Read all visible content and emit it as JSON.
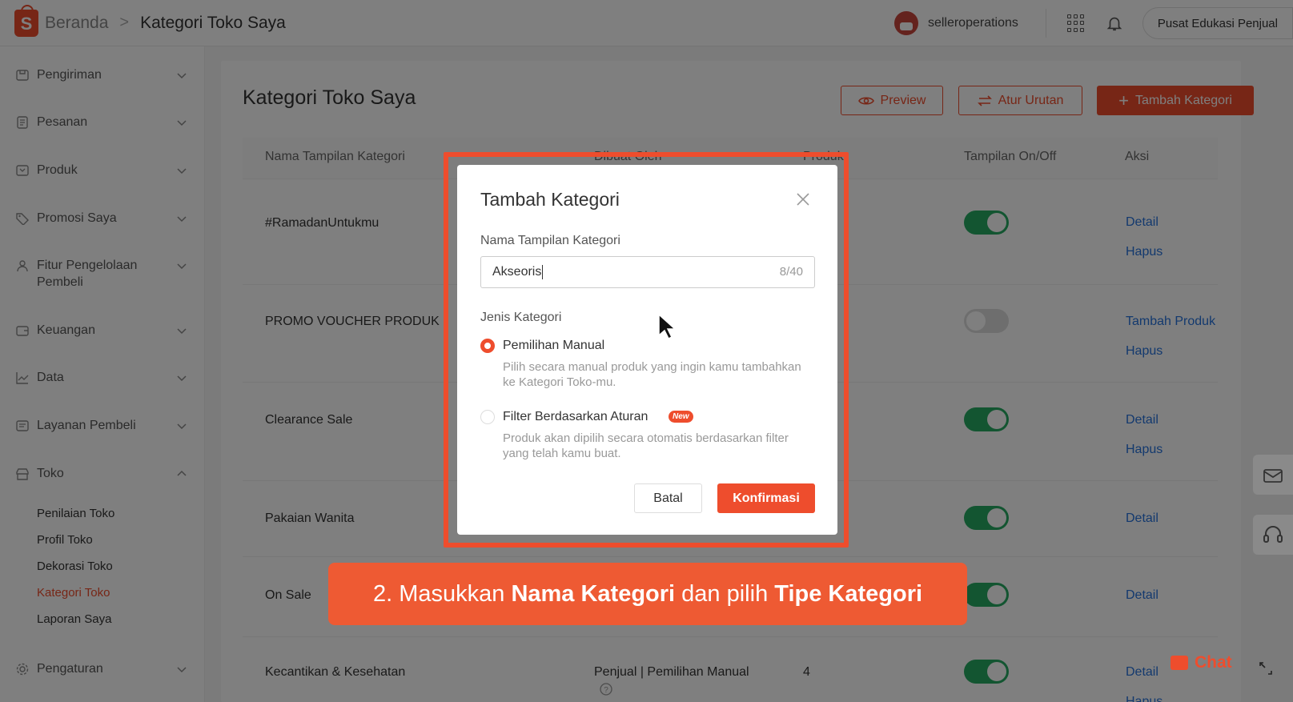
{
  "topbar": {
    "logo_text": "S",
    "breadcrumb_home": "Beranda",
    "breadcrumb_sep": ">",
    "breadcrumb_current": "Kategori Toko Saya",
    "username": "selleroperations",
    "pusat_btn": "Pusat Edukasi Penjual"
  },
  "sidebar": {
    "items": [
      {
        "label": "Pengiriman",
        "icon": "shipping-icon"
      },
      {
        "label": "Pesanan",
        "icon": "order-icon"
      },
      {
        "label": "Produk",
        "icon": "product-icon"
      },
      {
        "label": "Promosi Saya",
        "icon": "tag-icon"
      },
      {
        "label": "Fitur Pengelolaan Pembeli",
        "icon": "people-icon"
      },
      {
        "label": "Keuangan",
        "icon": "wallet-icon"
      },
      {
        "label": "Data",
        "icon": "chart-icon"
      },
      {
        "label": "Layanan Pembeli",
        "icon": "service-icon"
      },
      {
        "label": "Toko",
        "icon": "store-icon"
      },
      {
        "label": "Pengaturan",
        "icon": "settings-icon"
      }
    ],
    "toko_sub": [
      "Penilaian Toko",
      "Profil Toko",
      "Dekorasi Toko",
      "Kategori Toko",
      "Laporan Saya"
    ]
  },
  "main": {
    "title": "Kategori Toko Saya",
    "preview_btn": "Preview",
    "atur_btn": "Atur Urutan",
    "tambah_btn": "Tambah Kategori",
    "columns": [
      "Nama Tampilan Kategori",
      "Dibuat Oleh",
      "Produk",
      "Tampilan On/Off",
      "Aksi"
    ],
    "rows": [
      {
        "name": "#RamadanUntukmu",
        "toggle": true,
        "actions": [
          "Detail",
          "Hapus"
        ]
      },
      {
        "name": "PROMO VOUCHER PRODUK",
        "toggle": false,
        "actions": [
          "Tambah Produk",
          "Hapus"
        ]
      },
      {
        "name": "Clearance Sale",
        "toggle": true,
        "actions": [
          "Detail",
          "Hapus"
        ]
      },
      {
        "name": "Pakaian Wanita",
        "toggle": true,
        "actions": [
          "Detail"
        ]
      },
      {
        "name": "On Sale",
        "toggle": true,
        "actions": [
          "Detail"
        ]
      },
      {
        "name": "Kecantikan & Kesehatan",
        "created_by": "Penjual | Pemilihan Manual",
        "products": "4",
        "toggle": true,
        "actions": [
          "Detail",
          "Hapus"
        ]
      }
    ]
  },
  "modal": {
    "title": "Tambah Kategori",
    "name_label": "Nama Tampilan Kategori",
    "name_value": "Akseoris",
    "name_count": "8/40",
    "type_label": "Jenis Kategori",
    "opt1_label": "Pemilihan Manual",
    "opt1_desc": "Pilih secara manual produk yang ingin kamu tambahkan ke Kategori Toko-mu.",
    "opt2_label": "Filter Berdasarkan Aturan",
    "opt2_badge": "New",
    "opt2_desc": "Produk akan dipilih secara otomatis berdasarkan filter yang telah kamu buat.",
    "cancel": "Batal",
    "confirm": "Konfirmasi"
  },
  "banner": {
    "p1": "2. Masukkan ",
    "b1": "Nama Kategori",
    "p2": " dan pilih ",
    "b2": "Tipe Kategori"
  },
  "chat": "Chat",
  "colors": {
    "brand": "#ee4d2d",
    "link": "#2673dd",
    "toggle_on": "#26aa62"
  }
}
